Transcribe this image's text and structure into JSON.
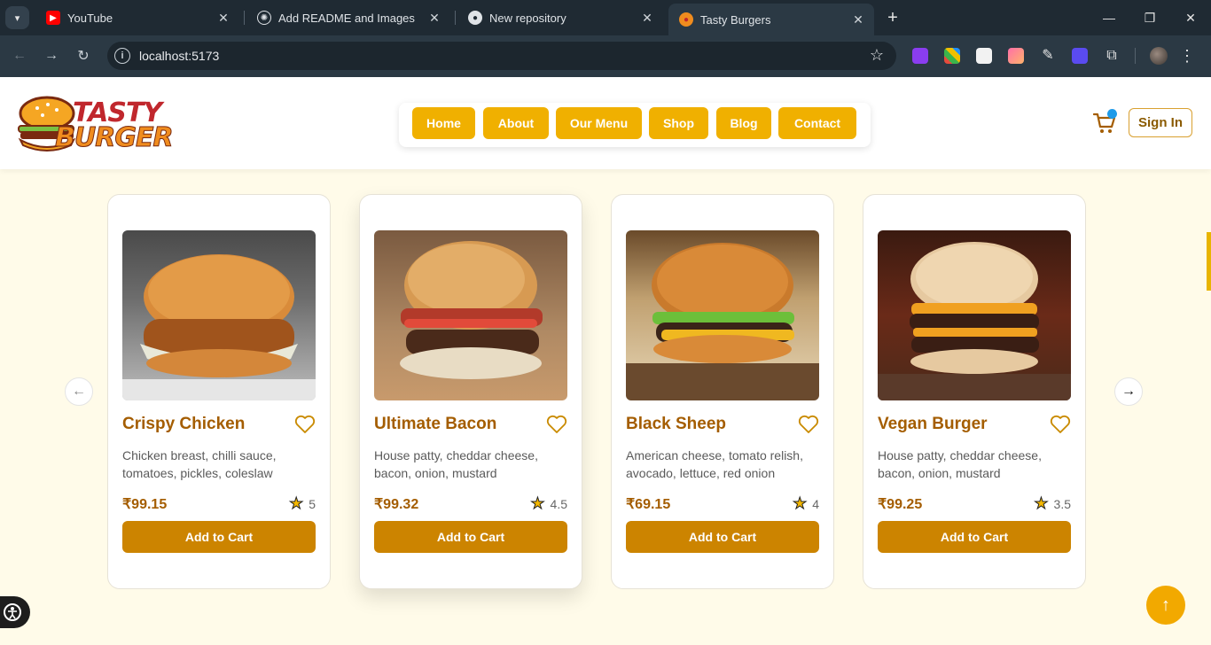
{
  "browser": {
    "tabs": [
      {
        "title": "YouTube",
        "active": false
      },
      {
        "title": "Add README and Images",
        "active": false
      },
      {
        "title": "New repository",
        "active": false
      },
      {
        "title": "Tasty Burgers",
        "active": true
      }
    ],
    "url": "localhost:5173"
  },
  "header": {
    "logo_line1": "TASTY",
    "logo_line2": "BURGER",
    "nav": [
      "Home",
      "About",
      "Our Menu",
      "Shop",
      "Blog",
      "Contact"
    ],
    "sign_in": "Sign In"
  },
  "products": [
    {
      "name": "Crispy Chicken",
      "desc": "Chicken breast, chilli sauce, tomatoes, pickles, coleslaw",
      "price": "₹99.15",
      "rating": "5",
      "cta": "Add to Cart"
    },
    {
      "name": "Ultimate Bacon",
      "desc": "House patty, cheddar cheese, bacon, onion, mustard",
      "price": "₹99.32",
      "rating": "4.5",
      "cta": "Add to Cart"
    },
    {
      "name": "Black Sheep",
      "desc": "American cheese, tomato relish, avocado, lettuce, red onion",
      "price": "₹69.15",
      "rating": "4",
      "cta": "Add to Cart"
    },
    {
      "name": "Vegan Burger",
      "desc": "House patty, cheddar cheese, bacon, onion, mustard",
      "price": "₹99.25",
      "rating": "3.5",
      "cta": "Add to Cart"
    }
  ],
  "colors": {
    "accent": "#f0b000",
    "button": "#cc8400",
    "title": "#a45d00",
    "background": "#fffbe9"
  }
}
